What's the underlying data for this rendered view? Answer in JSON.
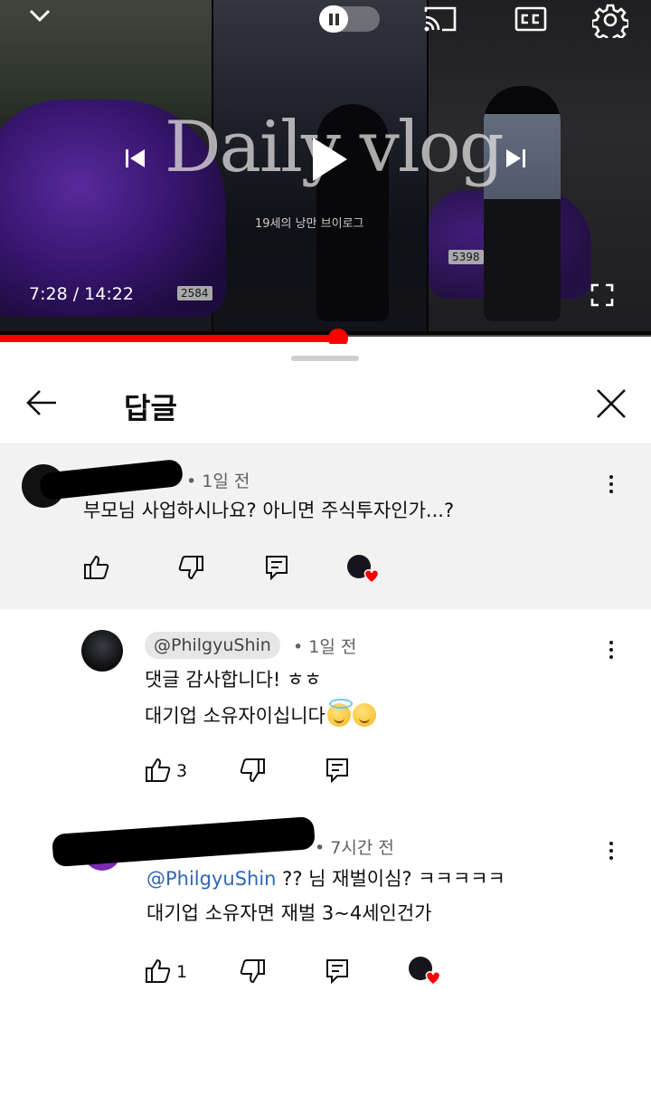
{
  "player": {
    "overlay_title": "Daily vlog",
    "overlay_subtitle": "19세의 낭만 브이로그",
    "plates": [
      "2584",
      "5398"
    ],
    "current_time": "7:28",
    "duration": "14:22",
    "time_display": "7:28 / 14:22",
    "progress_fraction": 0.52,
    "accent_color": "#ff0000",
    "icons": [
      "chevron-down-icon",
      "pause-icon",
      "cast-icon",
      "closed-captions-icon",
      "settings-gear-icon",
      "previous-icon",
      "play-icon",
      "next-icon",
      "fullscreen-icon"
    ]
  },
  "sheet": {
    "title": "답글",
    "icons": [
      "back-arrow-icon",
      "close-icon"
    ]
  },
  "comments": {
    "parent": {
      "author": "",
      "time": "1일 전",
      "text": "부모님 사업하시나요? 아니면 주식투자인가...?",
      "likes": "",
      "icons": [
        "like-icon",
        "dislike-icon",
        "reply-icon",
        "creator-heart-icon",
        "more-vert-icon"
      ]
    },
    "replies": [
      {
        "author": "@PhilgyuShin",
        "time": "1일 전",
        "line1": "댓글 감사합니다! ㅎㅎ",
        "line2": "대기업 소유자이십니다",
        "emojis": [
          "smiling-face-with-halo",
          "relieved-face"
        ],
        "likes": "3"
      },
      {
        "author": "",
        "time": "7시간 전",
        "mention": "@PhilgyuShin",
        "line1_rest": " ?? 님 재벌이심? ㅋㅋㅋㅋㅋ",
        "line2": "대기업 소유자면 재벌 3~4세인건가",
        "likes": "1"
      }
    ]
  }
}
